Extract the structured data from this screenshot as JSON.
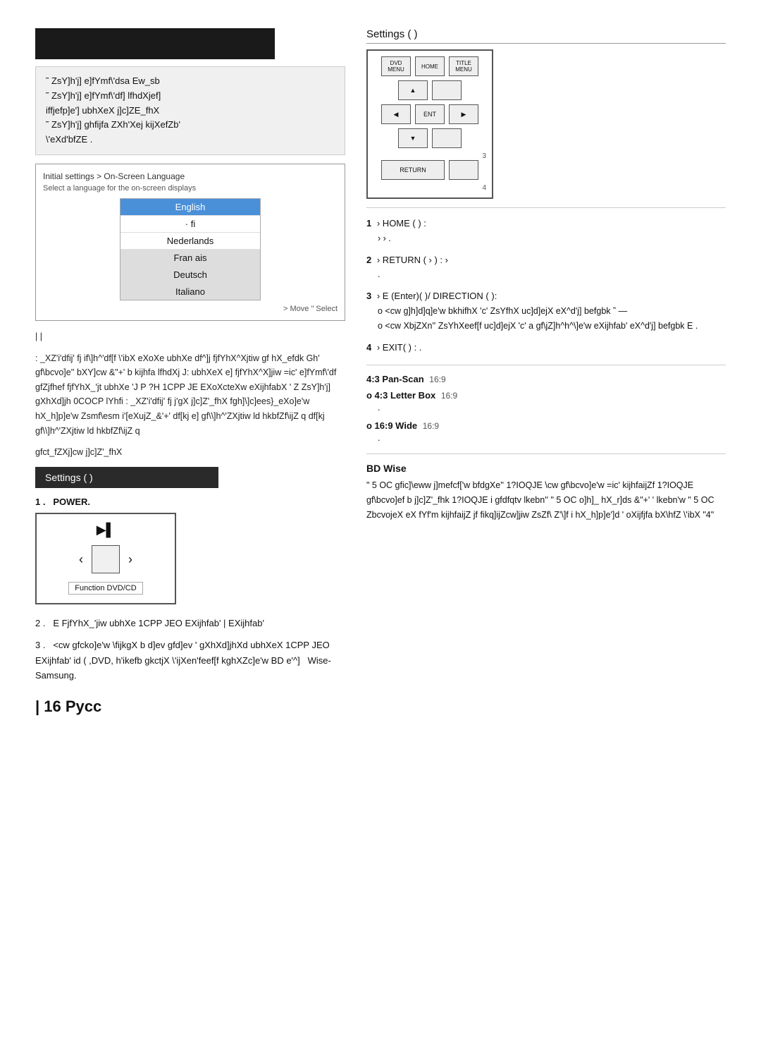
{
  "header": {
    "bar_placeholder": ""
  },
  "settings_title": "Settings (  )",
  "instruction_lines": [
    "˜  ZsY]h'j] e]fYmf\\'dsa Ew_sb",
    "˜  ZsY]h'j] e]fYmf\\'df] lfhdXjef]",
    "iffjefp]e'] ubhXeX j]c]ZE_fhX",
    "˜  ZsY]h'j] ghfijfa ZXh'Xej kijXefZb'",
    "\\'eXd'bfZE ."
  ],
  "language_box": {
    "title": "Initial settings > On-Screen Language",
    "subtitle": "Select a language for the on-screen displays",
    "languages": [
      {
        "name": "English",
        "state": "highlighted"
      },
      {
        "name": "· fi",
        "state": "normal"
      },
      {
        "name": "Nederlands",
        "state": "normal"
      },
      {
        "name": "Fran ais",
        "state": "selected"
      },
      {
        "name": "Deutsch",
        "state": "selected"
      },
      {
        "name": "Italiano",
        "state": "selected"
      }
    ],
    "nav_hint": "> Move  \" Select"
  },
  "body_text_1": "|       |",
  "body_text_2": ": _XZ'i'dfij' fj if\\]h^'df[f \\'ibX eXoXe ubhXe df^]j fjfYhX^Xjtiw gf hX_efdk Gh' gf\\bcvo]e'' bXY]cw &\"+' b kijhfa lfhdXj J: ubhXeX e] fjfYhX^X]jiw =ic' e]fYmf\\'df gfZjfhef fjfYhX_'jt ubhXe 'J P  ?H 1CPP JE  EXoXcteXw eXijhfabX ' Z ZsY]h'j] gXhXd]jh 0COCP  lYhfi : _XZ'i'dfij' fj j'gX j]c]Z'_fhX fgh]\\]c]ees}_eXo]e'w hX_h]p]e'w Zsmf\\esm i'[eXujZ_&'+' df[kj e] gf\\\\]h^'ZXjtiw ld  hkbfZf\\ijZ q df[kj gf\\\\]h^'ZXjtiw ld  hkbfZf\\ijZ q",
  "body_text_3": "gfct_fZXj]cw j]c]Z'_fhX",
  "settings_section": {
    "title": "Settings (  )"
  },
  "power_item": {
    "number": "1 .",
    "label": "POWER.",
    "device_icon": "▶▌",
    "nav_left": "‹",
    "nav_right": "›",
    "footer_label": "Function  DVD/CD"
  },
  "numbered_items_right": [
    {
      "num": "1",
      "content": "›  HOME (   )  :",
      "sub": "›  ›  ."
    },
    {
      "num": "2",
      "content": "›  RETURN ( ›  )   :  ›",
      "sub": "."
    },
    {
      "num": "3",
      "content": "›  E  (Enter)(  )/ DIRECTION (  ):",
      "detail_lines": [
        "o <cw g]h]d]q]e'w bkhifhX 'c' ZsYfhX uc]d]ejX eX^d'j] befgbk ˜ —",
        "o <cw XbjZXn'' ZsYhXeef[f uc]d]ejX 'c' a gf\\jZ]h^h^\\]e'w eXijhfab' eX^d'j] befgbk E ."
      ]
    },
    {
      "num": "4",
      "content": "›  EXIT(  )  :  ."
    }
  ],
  "aspect_section": {
    "intro": "4:3 Pan-Scan",
    "sub_intro": "16:9",
    "options": [
      {
        "label": "o 4:3 Letter Box",
        "sub": "16:9",
        "desc": "."
      },
      {
        "label": "o 16:9 Wide",
        "sub": "16:9",
        "desc": "."
      }
    ]
  },
  "bd_wise": {
    "title": "BD Wise",
    "text": "\" 5 OC  gfic]\\eww j]mefcf['w bfdgXe'' 1?IOQJE \\cw gf\\bcvo]e'w =ic' kijhfaijZf 1?IOQJE gf\\bcvo]ef b j]c]Z'_fhk 1?IOQJE i gfdfqtv lkebn'' \" 5 OC o]h]_ hX_r]ds &\"+' ' lkebn'w \" 5 OC ZbcvojeX eX fYf'm kijhfaijZ jf fikq]ijZcw]jiw ZsZf\\ Z'\\]f i hX_h]p]e']d ' oXijfjfa bX\\hfZ \\'ibX \"4\""
  },
  "lower_text_2": {
    "num": "2 .",
    "content": "E  FjfYhX_'jiw ubhXe 1CPP JEO EXijhfab' |    EXijhfab'"
  },
  "lower_text_3": {
    "num": "3 .",
    "content": "<cw gfcko]e'w \\fijkgX b d]ev gfd]ev ' gXhXd]jhXd ubhXeX 1CPP JEO  EXijhfab' id  (  ,DVD, h'ikefb gkctjX \\'ijXen'feef[f kghXZc]e'w BD e'^]"
  },
  "wise_label": "Wise-",
  "samsung_label": "Samsung.",
  "page_number": "| 16 Pycc"
}
